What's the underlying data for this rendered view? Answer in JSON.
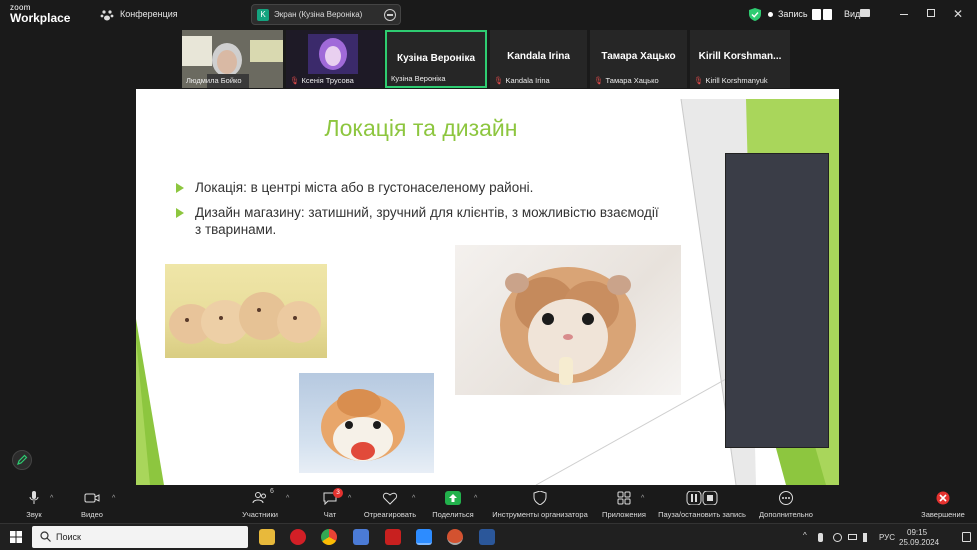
{
  "topbar": {
    "logo_top": "zoom",
    "logo_bottom": "Workplace",
    "conference_label": "Конференция",
    "share_badge": "K",
    "share_label": "Экран (Кузіна Вероніка)",
    "record_label": "Запись",
    "view_label": "Вид"
  },
  "participants": [
    {
      "name": "Людмила Бойко",
      "muted": false,
      "big": ""
    },
    {
      "name": "Ксенія Трусова",
      "muted": true,
      "big": ""
    },
    {
      "name": "Кузіна Вероніка",
      "muted": false,
      "big": "Кузіна Вероніка"
    },
    {
      "name": "Kandala Irina",
      "muted": true,
      "big": "Kandala Irina"
    },
    {
      "name": "Тамара Хацько",
      "muted": true,
      "big": "Тамара Хацько"
    },
    {
      "name": "Kirill Korshmanyuk",
      "muted": true,
      "big": "Kirill  Korshman..."
    }
  ],
  "slide": {
    "title": "Локація та дизайн",
    "bullets": [
      "Локація: в центрі міста або в густонаселеному районі.",
      "Дизайн магазину: затишний, зручний для клієнтів, з можливістю взаємодії з тваринами."
    ],
    "accent_color": "#8dc63f"
  },
  "toolbar": {
    "audio": "Звук",
    "video": "Видео",
    "participants": "Участники",
    "participants_count": "6",
    "chat": "Чат",
    "chat_badge": "3",
    "react": "Отреагировать",
    "share": "Поделиться",
    "host_tools": "Инструменты организатора",
    "apps": "Приложения",
    "pause_record": "Пауза/остановить запись",
    "more": "Дополнительно",
    "end": "Завершение"
  },
  "taskbar": {
    "search_placeholder": "Поиск",
    "lang": "РУС",
    "time": "09:15",
    "date": "25.09.2024"
  }
}
